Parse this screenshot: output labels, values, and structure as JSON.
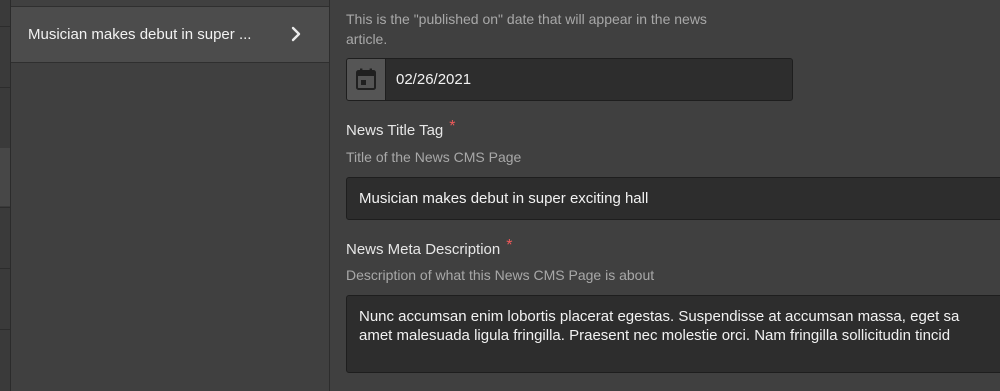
{
  "sidebar": {
    "items": [
      {
        "label": "Musician makes debut in super ...",
        "icon": "chevron-right-icon"
      }
    ]
  },
  "form": {
    "published_date": {
      "help_lines": [
        "This is the \"published on\" date that will appear in the news",
        "article."
      ],
      "icon": "calendar-icon",
      "value": "02/26/2021"
    },
    "news_title_tag": {
      "label": "News Title Tag",
      "required_marker": "*",
      "help": "Title of the News CMS Page",
      "value": "Musician makes debut in super exciting hall"
    },
    "news_meta_description": {
      "label": "News Meta Description",
      "required_marker": "*",
      "help": "Description of what this News CMS Page is about",
      "value_lines": [
        "Nunc accumsan enim lobortis placerat egestas. Suspendisse at accumsan massa, eget sa",
        "amet malesuada ligula fringilla. Praesent nec molestie orci. Nam fringilla sollicitudin tincid"
      ]
    }
  },
  "colors": {
    "background": "#404040",
    "input_background": "#2d2d2d",
    "required": "#f05a5a",
    "help_text": "#a8a8a8",
    "text": "#f2f2f2"
  }
}
